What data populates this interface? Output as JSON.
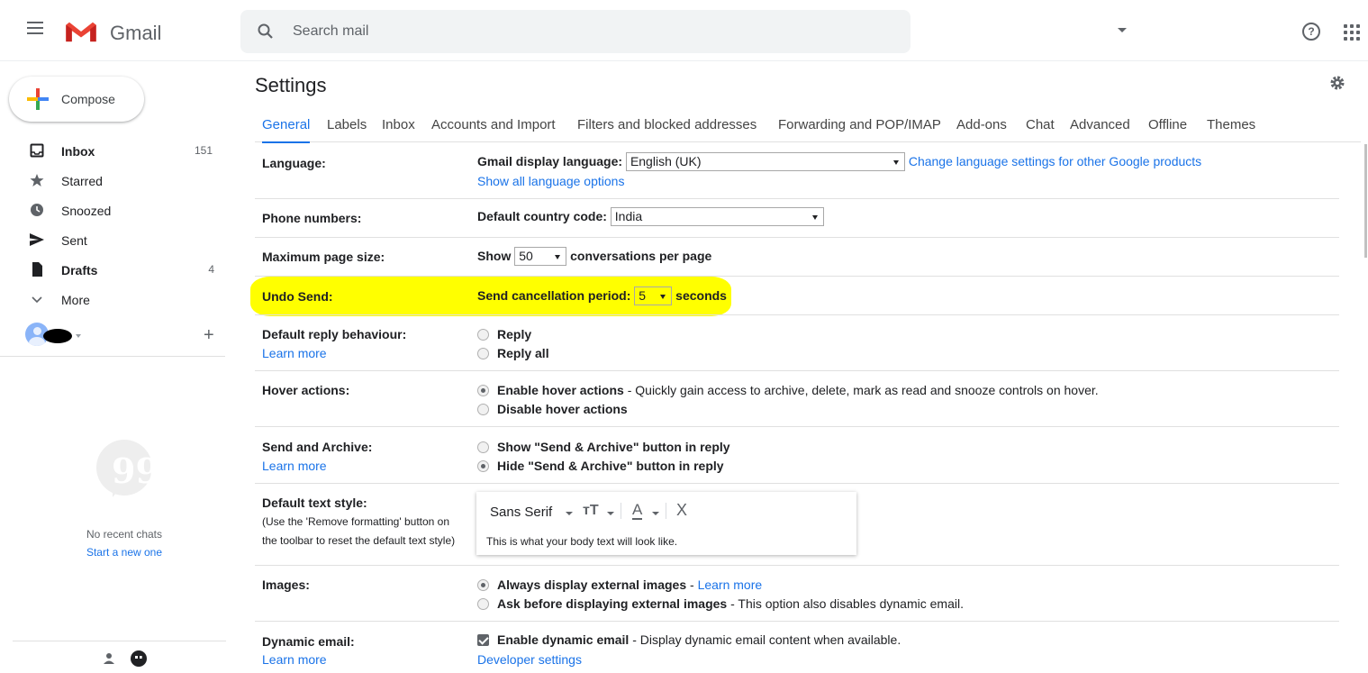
{
  "app": {
    "name": "Gmail"
  },
  "search": {
    "placeholder": "Search mail"
  },
  "compose": {
    "label": "Compose"
  },
  "nav": [
    {
      "label": "Inbox",
      "count": "151",
      "bold": true,
      "icon": "inbox-icon"
    },
    {
      "label": "Starred",
      "count": "",
      "bold": false,
      "icon": "star-icon"
    },
    {
      "label": "Snoozed",
      "count": "",
      "bold": false,
      "icon": "clock-icon"
    },
    {
      "label": "Sent",
      "count": "",
      "bold": false,
      "icon": "send-icon"
    },
    {
      "label": "Drafts",
      "count": "4",
      "bold": true,
      "icon": "file-icon"
    },
    {
      "label": "More",
      "count": "",
      "bold": false,
      "icon": "chevron-down-icon"
    }
  ],
  "hangouts": {
    "plus": "+",
    "no_chats": "No recent chats",
    "start_new": "Start a new one"
  },
  "settings": {
    "title": "Settings"
  },
  "tabs": [
    "General",
    "Labels",
    "Inbox",
    "Accounts and Import",
    "Filters and blocked addresses",
    "Forwarding and POP/IMAP",
    "Add-ons",
    "Chat",
    "Advanced",
    "Offline",
    "Themes"
  ],
  "active_tab": "General",
  "rows": {
    "language": {
      "label": "Language:",
      "field_label": "Gmail display language:",
      "value": "English (UK)",
      "link": "Change language settings for other Google products",
      "sub_link": "Show all language options"
    },
    "phone": {
      "label": "Phone numbers:",
      "field_label": "Default country code:",
      "value": "India"
    },
    "page_size": {
      "label": "Maximum page size:",
      "prefix": "Show",
      "value": "50",
      "suffix": "conversations per page"
    },
    "undo_send": {
      "label": "Undo Send:",
      "field_label": "Send cancellation period:",
      "value": "5",
      "suffix": "seconds",
      "highlight_color": "#ffff00"
    },
    "reply": {
      "label": "Default reply behaviour:",
      "learn_more": "Learn more",
      "options": [
        "Reply",
        "Reply all"
      ]
    },
    "hover": {
      "label": "Hover actions:",
      "option1": "Enable hover actions",
      "option1_desc": "- Quickly gain access to archive, delete, mark as read and snooze controls on hover.",
      "option2": "Disable hover actions"
    },
    "send_archive": {
      "label": "Send and Archive:",
      "learn_more": "Learn more",
      "option1": "Show \"Send & Archive\" button in reply",
      "option2": "Hide \"Send & Archive\" button in reply"
    },
    "text_style": {
      "label": "Default text style:",
      "help1": "(Use the 'Remove formatting' button on",
      "help2": "the toolbar to reset the default text style)",
      "font": "Sans Serif",
      "size_glyph": "тТ",
      "color_glyph": "A",
      "clear_glyph": "X",
      "preview": "This is what your body text will look like."
    },
    "images": {
      "label": "Images:",
      "option1": "Always display external images",
      "option1_sep": "-",
      "option1_link": "Learn more",
      "option2": "Ask before displaying external images",
      "option2_desc": "- This option also disables dynamic email."
    },
    "dynamic": {
      "label": "Dynamic email:",
      "learn_more": "Learn more",
      "option": "Enable dynamic email",
      "option_desc": "- Display dynamic email content when available.",
      "link": "Developer settings"
    }
  },
  "icons": {
    "menu": "menu-icon",
    "search": "search-icon",
    "help": "help-icon",
    "apps": "apps-icon",
    "gear": "gear-icon"
  },
  "colors": {
    "accent": "#1a73e8",
    "logo_red": "#ea4335"
  }
}
